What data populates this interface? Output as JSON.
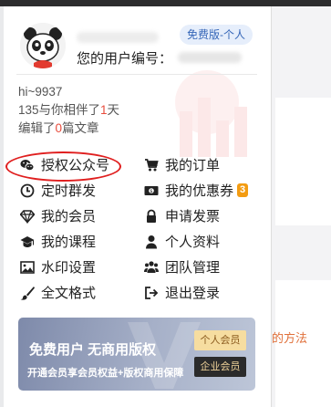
{
  "user": {
    "plan_badge": "免费版-个人",
    "user_id_label": "您的用户编号：",
    "handle": "hi~9937",
    "days_prefix": "135与你相伴了",
    "days_value": "1",
    "days_suffix": "天",
    "articles_prefix": "编辑了",
    "articles_value": "0",
    "articles_suffix": "篇文章"
  },
  "menu": {
    "left": [
      {
        "label": "授权公众号",
        "icon": "wechat-icon"
      },
      {
        "label": "定时群发",
        "icon": "clock-icon"
      },
      {
        "label": "我的会员",
        "icon": "diamond-icon"
      },
      {
        "label": "我的课程",
        "icon": "graduation-cap-icon"
      },
      {
        "label": "水印设置",
        "icon": "image-icon"
      },
      {
        "label": "全文格式",
        "icon": "brush-icon"
      }
    ],
    "right": [
      {
        "label": "我的订单",
        "icon": "cart-icon"
      },
      {
        "label": "我的优惠券",
        "icon": "coupon-icon",
        "count": "3"
      },
      {
        "label": "申请发票",
        "icon": "lock-icon"
      },
      {
        "label": "个人资料",
        "icon": "user-icon"
      },
      {
        "label": "团队管理",
        "icon": "users-icon"
      },
      {
        "label": "退出登录",
        "icon": "sign-out-icon"
      }
    ]
  },
  "promo": {
    "title": "免费用户 无商用版权",
    "subtitle": "开通会员享会员权益+版权商用保障",
    "personal_button": "个人会员",
    "enterprise_button": "企业会员"
  },
  "background": {
    "peek_text": "的方法"
  },
  "colors": {
    "accent_red": "#e84b3c",
    "badge_text": "#3566b8",
    "badge_bg": "#e6eefb",
    "coupon_badge": "#f39c12",
    "highlight_circle": "#e01f1f"
  }
}
